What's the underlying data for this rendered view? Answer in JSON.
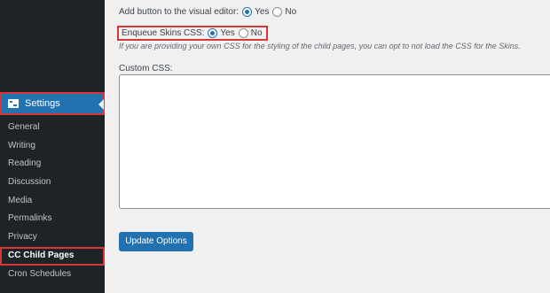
{
  "sidebar": {
    "menu_title": "Settings",
    "items": [
      {
        "label": "General"
      },
      {
        "label": "Writing"
      },
      {
        "label": "Reading"
      },
      {
        "label": "Discussion"
      },
      {
        "label": "Media"
      },
      {
        "label": "Permalinks"
      },
      {
        "label": "Privacy"
      },
      {
        "label": "CC Child Pages"
      },
      {
        "label": "Cron Schedules"
      }
    ]
  },
  "form": {
    "visual_editor": {
      "label": "Add button to the visual editor:",
      "yes": "Yes",
      "no": "No",
      "selected": "yes"
    },
    "enqueue_css": {
      "label": "Enqueue Skins CSS:",
      "yes": "Yes",
      "no": "No",
      "selected": "yes"
    },
    "description": "If you are providing your own CSS for the styling of the child pages, you can opt to not load the CSS for the Skins.",
    "custom_css_label": "Custom CSS:",
    "custom_css_value": "",
    "submit_label": "Update Options"
  },
  "colors": {
    "accent": "#2271b1",
    "sidebar_bg": "#1d2327",
    "highlight": "#d63638"
  },
  "icons": {
    "settings": "settings-icon"
  }
}
